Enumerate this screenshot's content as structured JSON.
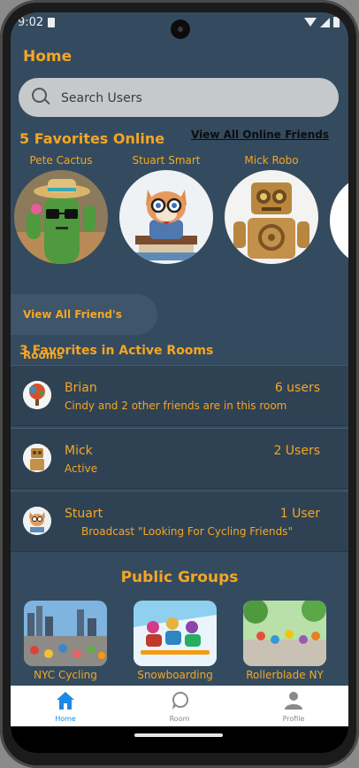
{
  "status": {
    "time": "9:02"
  },
  "header": {
    "title": "Home"
  },
  "search": {
    "placeholder": "Search Users"
  },
  "favorites_online": {
    "title": "5 Favorites Online",
    "view_all_label": "View All Online Friends",
    "friends": [
      {
        "name": "Pete Cactus",
        "avatar_icon": "cactus-avatar"
      },
      {
        "name": "Stuart Smart",
        "avatar_icon": "cat-avatar"
      },
      {
        "name": "Mick Robo",
        "avatar_icon": "robot-avatar"
      }
    ]
  },
  "rooms_button": {
    "label": "View All Friend's Rooms"
  },
  "active_rooms": {
    "title": "3 Favorites in Active Rooms",
    "rooms": [
      {
        "name": "Brian",
        "subtitle": "Cindy and 2 other friends are in this room",
        "count": "6 users"
      },
      {
        "name": "Mick",
        "subtitle": "Active",
        "count": "2 Users"
      },
      {
        "name": "Stuart",
        "subtitle": "Broadcast \"Looking For Cycling Friends\"",
        "count": "1 User"
      }
    ]
  },
  "public_groups": {
    "title": "Public Groups",
    "groups": [
      {
        "name": "NYC Cycling"
      },
      {
        "name": "Snowboarding"
      },
      {
        "name": "Rollerblade NY"
      }
    ]
  },
  "tabbar": {
    "tabs": [
      {
        "label": "Home",
        "icon": "home-icon",
        "active": true
      },
      {
        "label": "Room",
        "icon": "chat-bubble-icon",
        "active": false
      },
      {
        "label": "Profile",
        "icon": "person-icon",
        "active": false
      }
    ]
  },
  "colors": {
    "accent": "#f5a623",
    "background": "#344b5f",
    "tab_active": "#1e88e5"
  }
}
